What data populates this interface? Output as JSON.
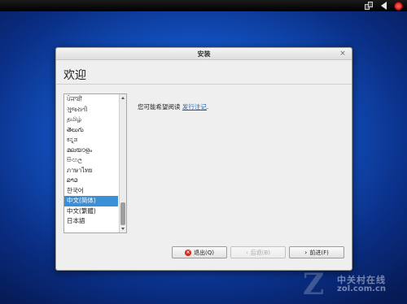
{
  "window": {
    "title": "安装",
    "close_glyph": "×",
    "heading": "欢迎"
  },
  "languages": [
    "ਪੰਜਾਬੀ",
    "ગુજરાતી",
    "தமிழ்",
    "తెలుగు",
    "ಕನ್ನಡ",
    "മലയാളം",
    "සිංහල",
    "ภาษาไทย",
    "ລາວ",
    "한국어",
    "中文(简体)",
    "中文(繁體)",
    "日本語"
  ],
  "selected_language": "中文(简体)",
  "message": {
    "prefix": "您可能希望阅读 ",
    "link": "发行注记",
    "suffix": "."
  },
  "buttons": {
    "quit": "退出(Q)",
    "back": "后退(B)",
    "forward": "前进(F)"
  },
  "watermark": {
    "letter": "Z",
    "brand_cn": "中关村在线",
    "url": "zol.com.cn"
  },
  "icons": {
    "network": "network-icon",
    "volume": "volume-icon",
    "power": "power-icon"
  },
  "colors": {
    "desktop": "#1456c8",
    "selection": "#3b8fd6",
    "link": "#1f63b8",
    "quit_icon": "#d42a1f"
  }
}
